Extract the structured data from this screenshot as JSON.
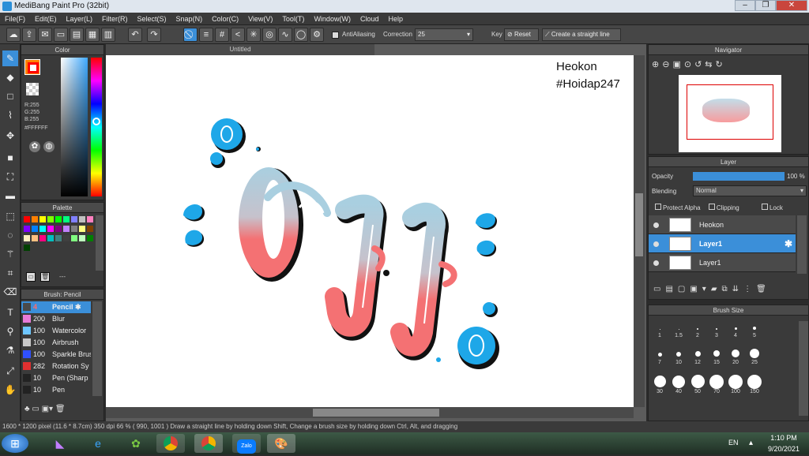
{
  "window": {
    "title": "MediBang Paint Pro (32bit)",
    "minimize": "–",
    "restore": "❐",
    "close": "✕"
  },
  "menu": [
    "File(F)",
    "Edit(E)",
    "Layer(L)",
    "Filter(R)",
    "Select(S)",
    "Snap(N)",
    "Color(C)",
    "View(V)",
    "Tool(T)",
    "Window(W)",
    "Cloud",
    "Help"
  ],
  "toolbar": {
    "antialiasing_label": "AntiAliasing",
    "correction_label": "Correction",
    "correction_value": "25",
    "key_label": "Key",
    "reset_label": "Reset",
    "straight_line_label": "Create a straight line"
  },
  "color_panel": {
    "title": "Color",
    "r": "R:255",
    "g": "G:255",
    "b": "B:255",
    "hex": "#FFFFFF",
    "primary": "#ff0000",
    "secondary": "#ff8000"
  },
  "palette_panel": {
    "title": "Palette",
    "extra": "---"
  },
  "palette_colors": [
    "#ff0000",
    "#ff8000",
    "#ffff00",
    "#80ff00",
    "#00ff00",
    "#00ff80",
    "#8080ff",
    "#c0c0c0",
    "#ff80c0",
    "#8000ff",
    "#0080ff",
    "#00ffff",
    "#ff00ff",
    "#800080",
    "#c080ff",
    "#808080",
    "#ffff80",
    "#804000",
    "#fff0c0",
    "#ffc080",
    "#ff0080",
    "#00c0c0",
    "#408080",
    "#404040",
    "#80ff80",
    "#c0ffc0",
    "#008000",
    "#004000"
  ],
  "brush_panel": {
    "title": "Brush: Pencil",
    "items": [
      {
        "size": "4",
        "name": "Pencil",
        "color": "#4a4a4a"
      },
      {
        "size": "200",
        "name": "Blur",
        "color": "#e87ad8"
      },
      {
        "size": "100",
        "name": "Watercolor",
        "color": "#6ec6ff"
      },
      {
        "size": "100",
        "name": "Airbrush",
        "color": "#c8c8c8"
      },
      {
        "size": "100",
        "name": "Sparkle Brush",
        "color": "#3050ff"
      },
      {
        "size": "282",
        "name": "Rotation Sy",
        "color": "#e03030"
      },
      {
        "size": "10",
        "name": "Pen (Sharp",
        "color": "#222222"
      },
      {
        "size": "10",
        "name": "Pen",
        "color": "#222222"
      }
    ]
  },
  "canvas": {
    "tab_title": "Untitled",
    "watermark_line1": "Heokon",
    "watermark_line2": "#Hoidap247"
  },
  "navigator": {
    "title": "Navigator"
  },
  "layer_panel": {
    "title": "Layer",
    "opacity_label": "Opacity",
    "opacity_value": "100 %",
    "opacity_fraction": 1.0,
    "blending_label": "Blending",
    "blending_value": "Normal",
    "protect_alpha": "Protect Alpha",
    "clipping": "Clipping",
    "lock": "Lock",
    "layers": [
      {
        "name": "Heokon",
        "selected": false
      },
      {
        "name": "Layer1",
        "selected": true
      },
      {
        "name": "Layer1",
        "selected": false
      }
    ]
  },
  "brush_size_panel": {
    "title": "Brush Size",
    "row1": [
      "1",
      "1.5",
      "2",
      "3",
      "4",
      "5"
    ],
    "row2": [
      "7",
      "10",
      "12",
      "15",
      "20",
      "25"
    ],
    "row3": [
      "30",
      "40",
      "50",
      "70",
      "100",
      "150"
    ]
  },
  "status": {
    "text": "1600 * 1200 pixel   (11.6 * 8.7cm)   350 dpi   66 %   ( 990, 1001 )   Draw a straight line by holding down Shift, Change a brush size by holding down Ctrl, Alt, and dragging"
  },
  "taskbar": {
    "language": "EN",
    "time": "1:10 PM",
    "date": "9/20/2021",
    "zalo_label": "Zalo"
  },
  "colors": {
    "accent": "#3b8fd9",
    "blue_drawing": "#1ea7e8",
    "pink_drawing": "#f47173",
    "light_blue_drawing": "#a9cfe0"
  }
}
